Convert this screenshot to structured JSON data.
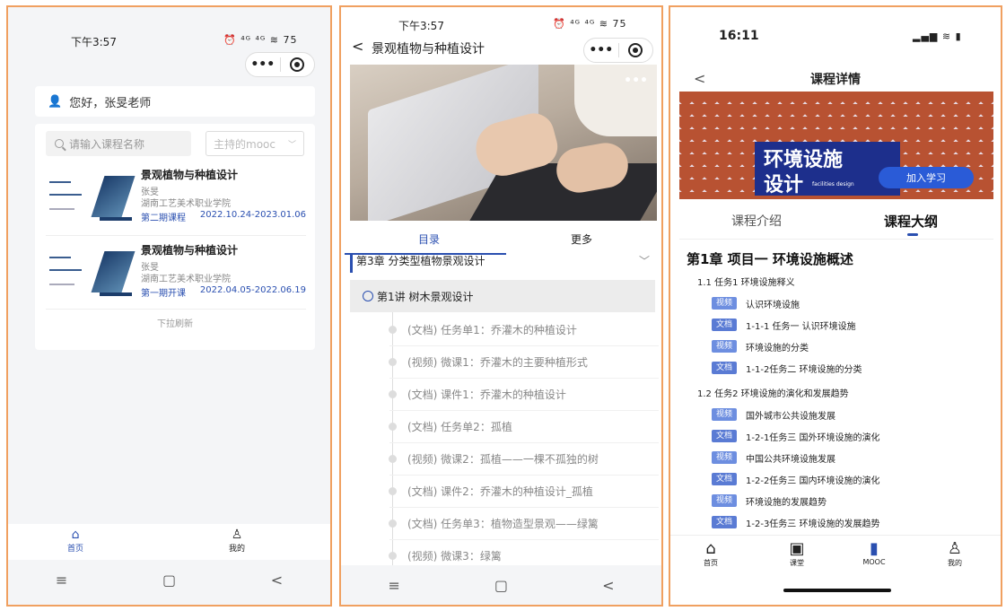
{
  "panel1": {
    "status_time": "下午3:57",
    "status_icons": "⏰ ⁴ᴳ ⁴ᴳ ≋ 75",
    "capsule_more": "•••",
    "greeting": "您好，张旻老师",
    "search_placeholder": "请输入课程名称",
    "filter_selected": "主持的mooc",
    "courses": [
      {
        "title": "景观植物与种植设计",
        "teacher": "张旻",
        "school": "湖南工艺美术职业学院",
        "term": "第二期课程",
        "dates": "2022.10.24-2023.01.06"
      },
      {
        "title": "景观植物与种植设计",
        "teacher": "张旻",
        "school": "湖南工艺美术职业学院",
        "term": "第一期开课",
        "dates": "2022.04.05-2022.06.19"
      }
    ],
    "refresh_hint": "下拉刷新",
    "tabs": [
      {
        "label": "首页",
        "icon": "home-icon"
      },
      {
        "label": "我的",
        "icon": "person-icon"
      }
    ],
    "nav": [
      "≡",
      "▢",
      "<"
    ]
  },
  "panel2": {
    "status_time": "下午3:57",
    "status_icons": "⏰ ⁴ᴳ ⁴ᴳ ≋ 75",
    "back": "<",
    "title": "景观植物与种植设计",
    "capsule_more": "•••",
    "hero_more": "•••",
    "tabs": [
      "目录",
      "更多"
    ],
    "chapter": "第3章 分类型植物景观设计",
    "lecture": "第1讲 树木景观设计",
    "items": [
      "(文档) 任务单1：乔灌木的种植设计",
      "(视频) 微课1：乔灌木的主要种植形式",
      "(文档) 课件1：乔灌木的种植设计",
      "(文档) 任务单2：孤植",
      "(视频) 微课2：孤植——一棵不孤独的树",
      "(文档) 课件2：乔灌木的种植设计_孤植",
      "(文档) 任务单3：植物造型景观——绿篱",
      "(视频) 微课3：绿篱"
    ],
    "nav": [
      "≡",
      "▢",
      "<"
    ]
  },
  "panel3": {
    "status_time": "16:11",
    "status_icons": "▂▄▆ ≋ ▮",
    "back": "<",
    "title": "课程详情",
    "banner_line1": "环境设施",
    "banner_line2": "设计",
    "banner_en": "facilities design",
    "join_button": "加入学习",
    "tabs": [
      "课程介绍",
      "课程大纲"
    ],
    "chapter": "第1章 项目一 环境设施概述",
    "sections": [
      {
        "title": "1.1 任务1 环境设施释义",
        "rows": [
          {
            "tag": "视频",
            "text": "认识环境设施"
          },
          {
            "tag": "文档",
            "text": "1-1-1 任务一 认识环境设施"
          },
          {
            "tag": "视频",
            "text": "环境设施的分类"
          },
          {
            "tag": "文档",
            "text": "1-1-2任务二 环境设施的分类"
          }
        ]
      },
      {
        "title": "1.2 任务2 环境设施的演化和发展趋势",
        "rows": [
          {
            "tag": "视频",
            "text": "国外城市公共设施发展"
          },
          {
            "tag": "文档",
            "text": "1-2-1任务三 国外环境设施的演化"
          },
          {
            "tag": "视频",
            "text": "中国公共环境设施发展"
          },
          {
            "tag": "文档",
            "text": "1-2-2任务三 国内环境设施的演化"
          },
          {
            "tag": "视频",
            "text": "环境设施的发展趋势"
          },
          {
            "tag": "文档",
            "text": "1-2-3任务三 环境设施的发展趋势"
          }
        ]
      }
    ],
    "tabbar": [
      {
        "label": "首页",
        "icon": "⌂"
      },
      {
        "label": "课堂",
        "icon": "▣"
      },
      {
        "label": "MOOC",
        "icon": "▮"
      },
      {
        "label": "我的",
        "icon": "♙"
      }
    ]
  },
  "colors": {
    "accent": "#2a4fb0",
    "frame": "#f0a060",
    "tag": "#5a7bd4"
  }
}
